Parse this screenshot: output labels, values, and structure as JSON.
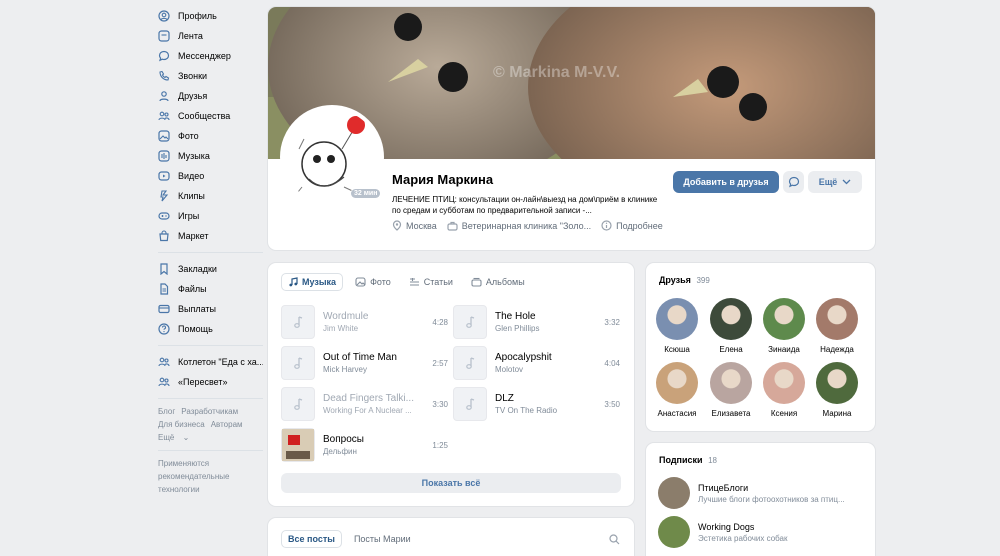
{
  "sidebar": {
    "items": [
      {
        "label": "Профиль",
        "icon": "profile-icon"
      },
      {
        "label": "Лента",
        "icon": "news-icon"
      },
      {
        "label": "Мессенджер",
        "icon": "messenger-icon"
      },
      {
        "label": "Звонки",
        "icon": "calls-icon"
      },
      {
        "label": "Друзья",
        "icon": "friends-icon"
      },
      {
        "label": "Сообщества",
        "icon": "communities-icon"
      },
      {
        "label": "Фото",
        "icon": "photo-icon"
      },
      {
        "label": "Музыка",
        "icon": "music-icon"
      },
      {
        "label": "Видео",
        "icon": "video-icon"
      },
      {
        "label": "Клипы",
        "icon": "clips-icon"
      },
      {
        "label": "Игры",
        "icon": "games-icon"
      },
      {
        "label": "Маркет",
        "icon": "market-icon"
      }
    ],
    "items2": [
      {
        "label": "Закладки",
        "icon": "bookmarks-icon"
      },
      {
        "label": "Файлы",
        "icon": "files-icon"
      },
      {
        "label": "Выплаты",
        "icon": "payments-icon"
      },
      {
        "label": "Помощь",
        "icon": "help-icon"
      }
    ],
    "groups": [
      {
        "label": "Котлетон \"Еда с ха..."
      },
      {
        "label": "«Пересвет»"
      }
    ],
    "footer_links": [
      "Блог",
      "Разработчикам",
      "Для бизнеса",
      "Авторам",
      "Ещё"
    ],
    "recommend_note": "Применяются рекомендательные технологии"
  },
  "profile": {
    "cover_watermark": "© Markina M-V.V.",
    "name": "Мария Маркина",
    "online": "32 мин",
    "status": "ЛЕЧЕНИЕ ПТИЦ: консультации он-лайн\\выезд на дом\\приём в клинике по средам и субботам по предварительной записи -...",
    "city": "Москва",
    "work": "Ветеринарная клиника \"Золо...",
    "more": "Подробнее",
    "add_friend": "Добавить в друзья",
    "more_btn": "Ещё"
  },
  "media": {
    "tabs": [
      "Музыка",
      "Фото",
      "Статьи",
      "Альбомы"
    ],
    "tracks": [
      {
        "title": "Wordmule",
        "artist": "Jim White",
        "duration": "4:28",
        "dim": true
      },
      {
        "title": "The Hole",
        "artist": "Glen Phillips",
        "duration": "3:32",
        "dim": false
      },
      {
        "title": "Out of Time Man",
        "artist": "Mick Harvey",
        "duration": "2:57",
        "dim": false
      },
      {
        "title": "Apocalypshit",
        "artist": "Molotov",
        "duration": "4:04",
        "dim": false
      },
      {
        "title": "Dead Fingers Talki...",
        "artist": "Working For A Nuclear ...",
        "duration": "3:30",
        "dim": true
      },
      {
        "title": "DLZ",
        "artist": "TV On The Radio",
        "duration": "3:50",
        "dim": false
      },
      {
        "title": "Вопросы",
        "artist": "Дельфин",
        "duration": "1:25",
        "dim": false
      }
    ],
    "show_all": "Показать всё"
  },
  "posts": {
    "tabs": [
      "Все посты",
      "Посты Марии"
    ]
  },
  "friends": {
    "title": "Друзья",
    "count": "399",
    "people": [
      {
        "name": "Ксюша",
        "color": "#7a8fb0"
      },
      {
        "name": "Елена",
        "color": "#3d4a3a"
      },
      {
        "name": "Зинаида",
        "color": "#5e8a4c"
      },
      {
        "name": "Надежда",
        "color": "#a37a6a"
      },
      {
        "name": "Анастасия",
        "color": "#c9a27a"
      },
      {
        "name": "Елизавета",
        "color": "#b9a5a0"
      },
      {
        "name": "Ксения",
        "color": "#d6a89a"
      },
      {
        "name": "Марина",
        "color": "#4f6a3d"
      }
    ]
  },
  "subscriptions": {
    "title": "Подписки",
    "count": "18",
    "items": [
      {
        "name": "ПтицеБлоги",
        "desc": "Лучшие блоги фотоохотников за птиц...",
        "color": "#8b7d6b"
      },
      {
        "name": "Working Dogs",
        "desc": "Эстетика рабочих собак",
        "color": "#6f8a4a"
      }
    ]
  }
}
